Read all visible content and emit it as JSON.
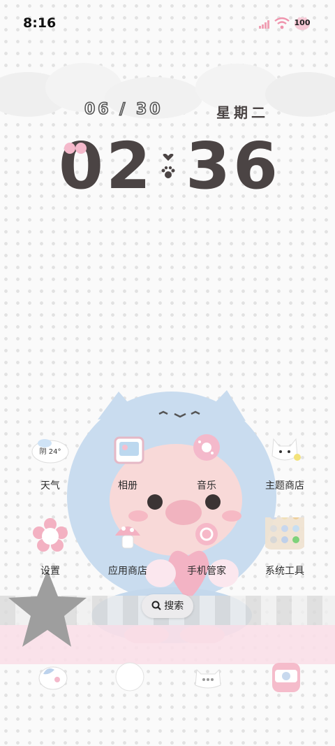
{
  "status_bar": {
    "time": "8:16",
    "battery": "100"
  },
  "lock_widget": {
    "date": "06 / 30",
    "weekday": "星期二",
    "hour": "02",
    "minute": "36"
  },
  "weather": {
    "badge": "阴 24°"
  },
  "apps": [
    {
      "label": "天气"
    },
    {
      "label": "相册"
    },
    {
      "label": "音乐"
    },
    {
      "label": "主题商店"
    },
    {
      "label": "设置"
    },
    {
      "label": "应用商店"
    },
    {
      "label": "手机管家"
    },
    {
      "label": "系统工具"
    }
  ],
  "search": {
    "label": "搜索"
  },
  "colors": {
    "accent_pink": "#f4b9cb",
    "text_dark": "#4b4444",
    "mascot_blue": "#c9dcef"
  }
}
